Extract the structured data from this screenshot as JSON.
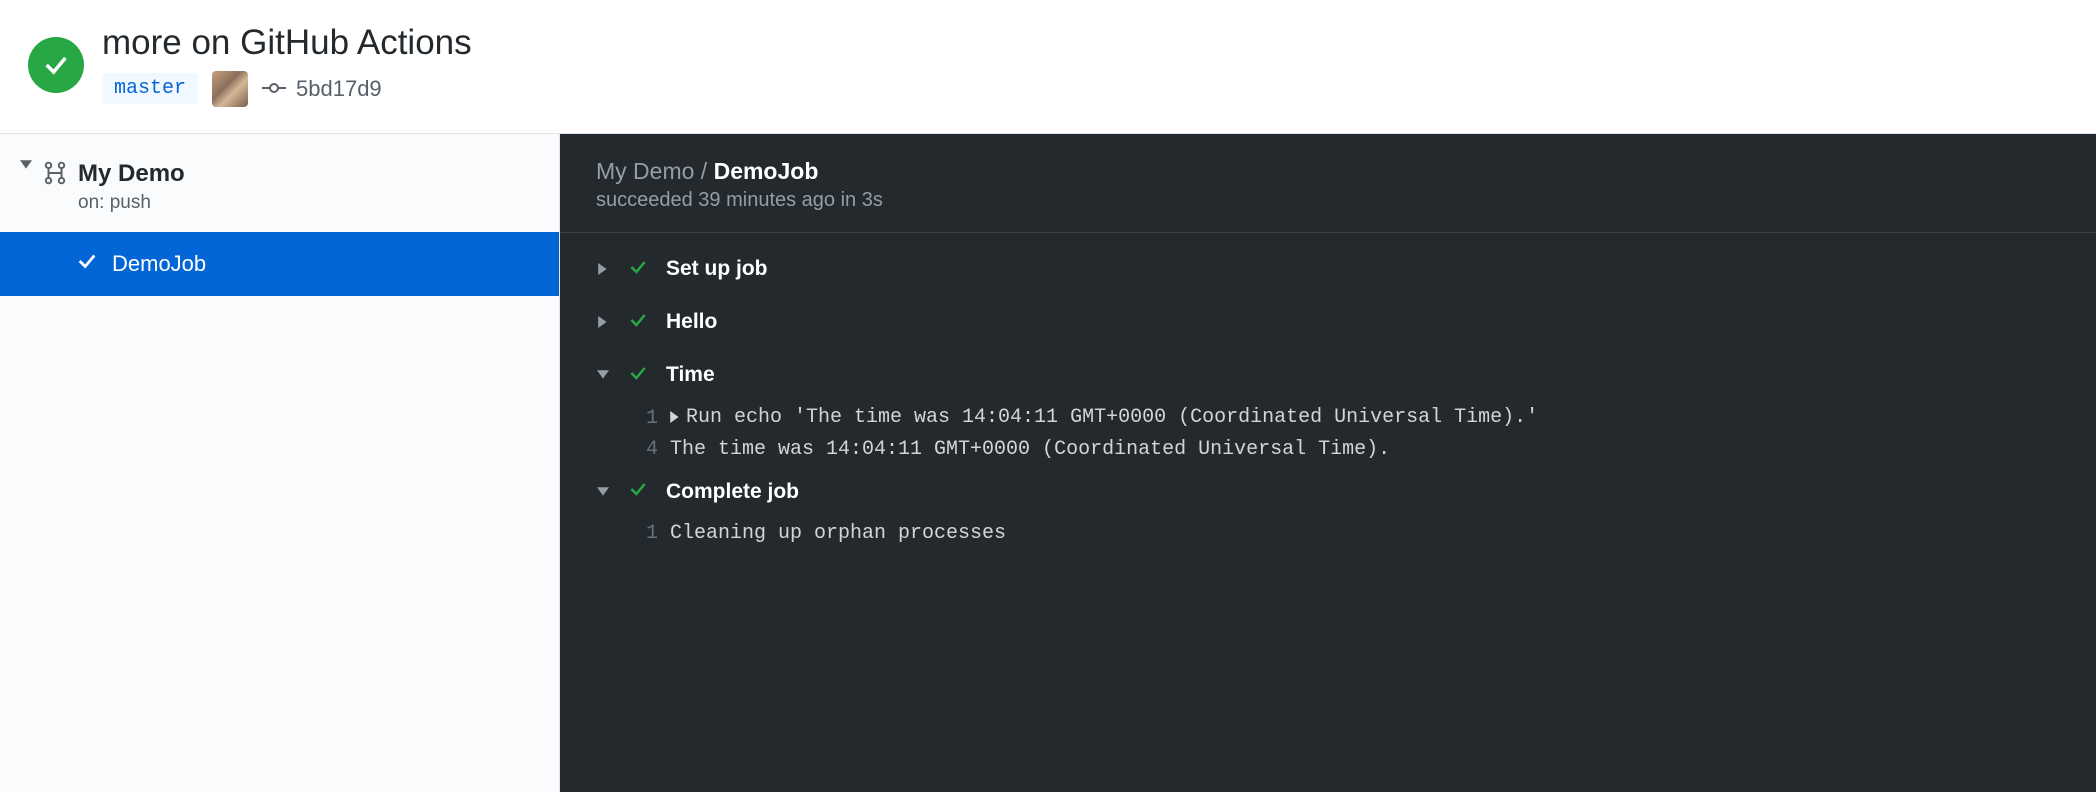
{
  "header": {
    "title": "more on GitHub Actions",
    "branch": "master",
    "commit_sha": "5bd17d9"
  },
  "sidebar": {
    "workflow_name": "My Demo",
    "trigger_text": "on: push",
    "jobs": [
      {
        "name": "DemoJob",
        "status": "success",
        "selected": true
      }
    ]
  },
  "log": {
    "breadcrumb_workflow": "My Demo",
    "breadcrumb_sep": " / ",
    "breadcrumb_job": "DemoJob",
    "status_text": "succeeded 39 minutes ago in 3s",
    "steps": [
      {
        "name": "Set up job",
        "expanded": false
      },
      {
        "name": "Hello",
        "expanded": false
      },
      {
        "name": "Time",
        "expanded": true,
        "lines": [
          {
            "n": "1",
            "expandable": true,
            "text": "Run echo 'The time was 14:04:11 GMT+0000 (Coordinated Universal Time).'"
          },
          {
            "n": "4",
            "expandable": false,
            "text": "The time was 14:04:11 GMT+0000 (Coordinated Universal Time)."
          }
        ]
      },
      {
        "name": "Complete job",
        "expanded": true,
        "lines": [
          {
            "n": "1",
            "expandable": false,
            "text": "Cleaning up orphan processes"
          }
        ]
      }
    ]
  }
}
